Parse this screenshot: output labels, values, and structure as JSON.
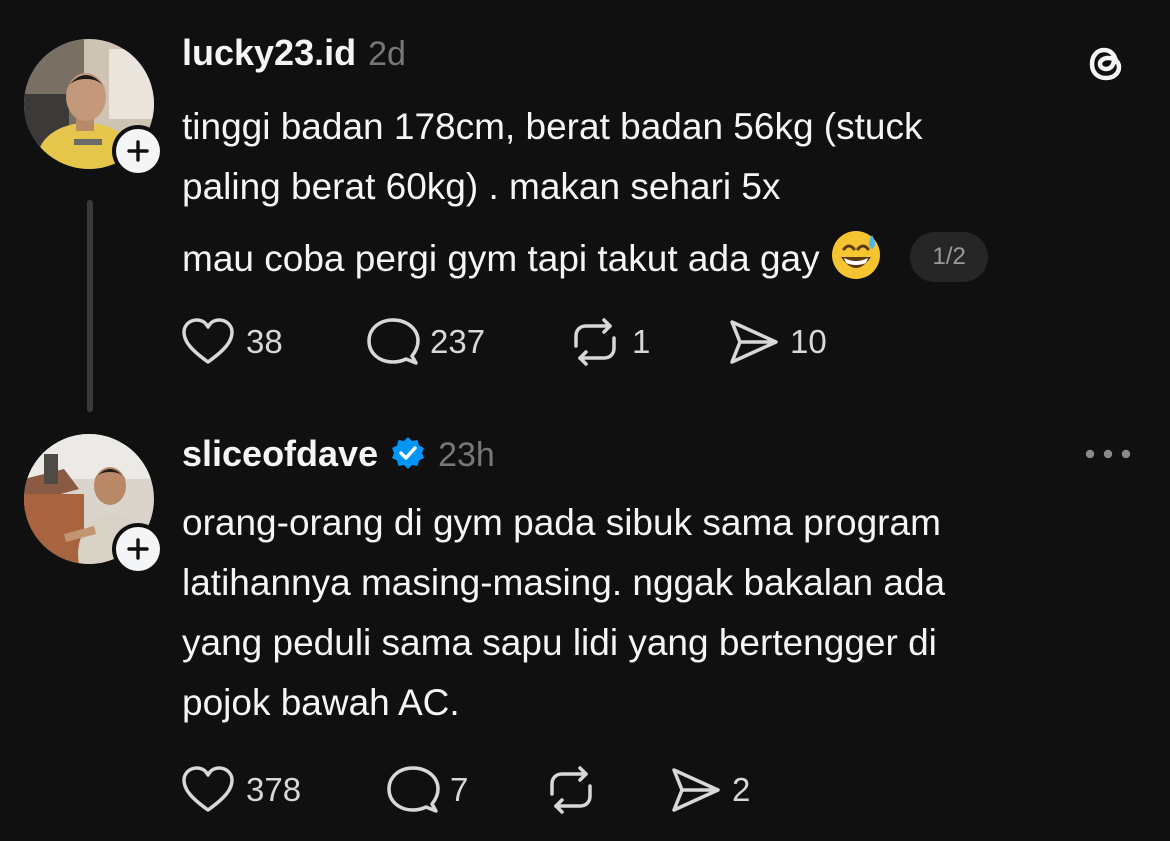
{
  "posts": [
    {
      "username": "lucky23.id",
      "time": "2d",
      "text_lines": [
        "tinggi badan 178cm, berat badan 56kg (stuck",
        "paling berat 60kg) . makan sehari 5x"
      ],
      "text_second": "mau coba pergi gym tapi takut ada gay",
      "emoji": "grinning-sweat-emoji",
      "page_indicator": "1/2",
      "likes": "38",
      "replies": "237",
      "reposts": "1",
      "shares": "10"
    },
    {
      "username": "sliceofdave",
      "verified": true,
      "time": "23h",
      "text_lines": [
        "orang-orang di gym pada sibuk sama program",
        "latihannya masing-masing. nggak bakalan ada",
        "yang peduli sama sapu lidi yang bertengger di",
        "pojok bawah AC."
      ],
      "likes": "378",
      "replies": "7",
      "reposts": "",
      "shares": "2"
    }
  ],
  "icons": {
    "app_logo": "threads-logo-icon",
    "more": "more-horizontal-icon",
    "like": "heart-icon",
    "reply": "comment-icon",
    "repost": "repost-icon",
    "share": "send-icon",
    "verified": "verified-badge-icon",
    "follow": "plus-icon"
  },
  "colors": {
    "background": "#101010",
    "text": "#f3f5f7",
    "muted": "#777777",
    "verified": "#0095f6"
  }
}
